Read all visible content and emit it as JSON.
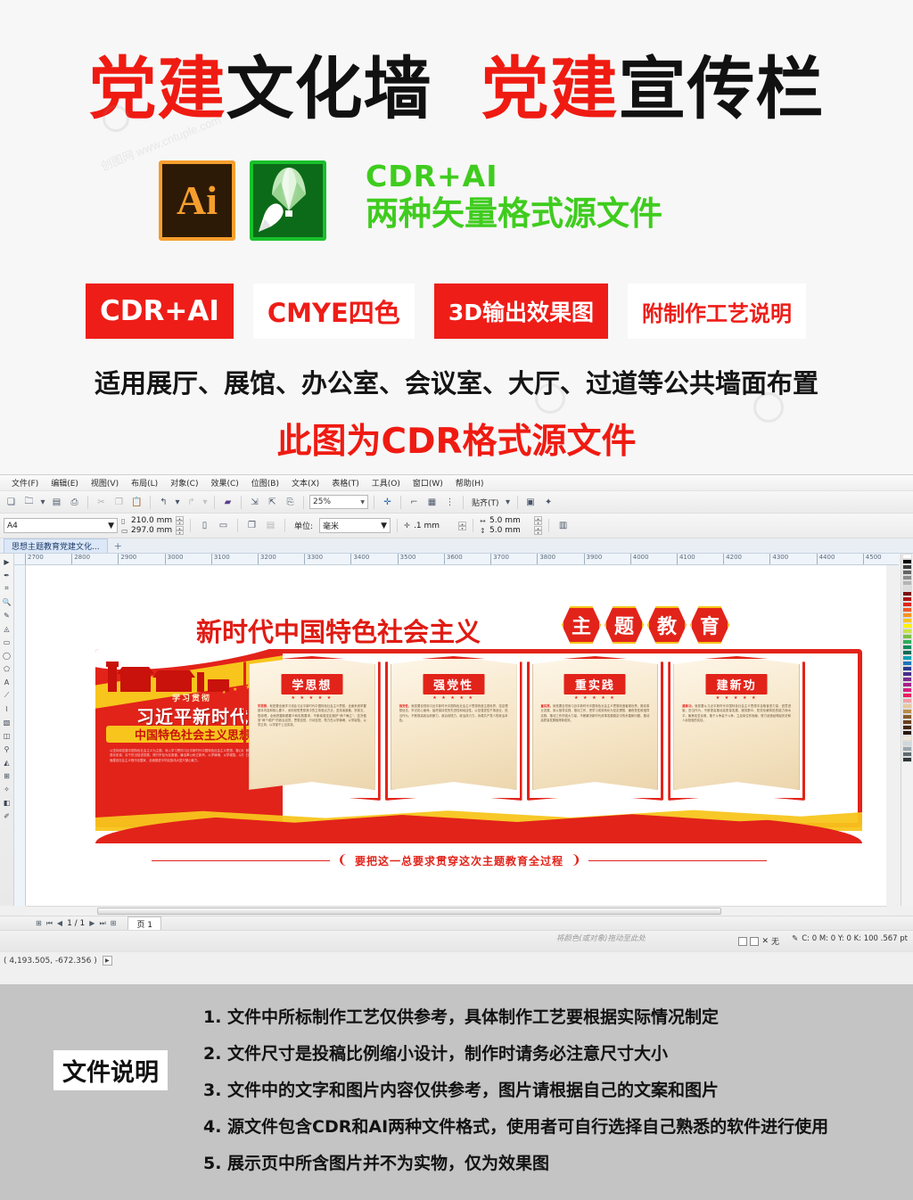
{
  "promo": {
    "title_parts": [
      {
        "text": "党建",
        "color": "red"
      },
      {
        "text": "文化墙",
        "color": "black"
      },
      {
        "text": " ",
        "color": "black"
      },
      {
        "text": "党建",
        "color": "red"
      },
      {
        "text": "宣传栏",
        "color": "black"
      }
    ],
    "title_red_1": "党建",
    "title_black_1": "文化墙",
    "title_red_2": "党建",
    "title_black_2": "宣传栏",
    "ai_icon_label": "Ai",
    "cdr_icon_label": "coreldraw-balloon-icon",
    "green_line1": "CDR+AI",
    "green_line2": "两种矢量格式源文件",
    "badges": [
      {
        "label": "CDR+AI",
        "style": "fill"
      },
      {
        "label": "CMYE四色",
        "style": "hollow"
      },
      {
        "label": "3D输出效果图",
        "style": "fill"
      },
      {
        "label": "附制作工艺说明",
        "style": "hollow"
      }
    ],
    "line1": "适用展厅、展馆、办公室、会议室、大厅、过道等公共墙面布置",
    "line2": "此图为CDR格式源文件",
    "watermark": "创图网 www.cntuple.com"
  },
  "colors": {
    "red": "#ee1d18",
    "art_red": "#e2231a",
    "yellow": "#f7c51c",
    "green": "#3fcc1e",
    "footer_bg": "#c4c4c4"
  },
  "app": {
    "menus": [
      "文件(F)",
      "编辑(E)",
      "视图(V)",
      "布局(L)",
      "对象(C)",
      "效果(C)",
      "位图(B)",
      "文本(X)",
      "表格(T)",
      "工具(O)",
      "窗口(W)",
      "帮助(H)"
    ],
    "toolbar": {
      "icons": [
        "new-icon",
        "open-icon",
        "open-dropdown-icon",
        "save-icon",
        "print-icon",
        "cut-icon",
        "copy-icon",
        "paste-icon",
        "undo-icon",
        "undo-dropdown-icon",
        "redo-icon",
        "redo-dropdown-icon",
        "import-icon",
        "export-icon",
        "publish-pdf-icon",
        "application-launcher-icon"
      ],
      "zoom_value": "25%",
      "snap_label": "贴齐(T)",
      "options_icon": "options-icon"
    },
    "propbar": {
      "page_size": "A4",
      "width": "210.0 mm",
      "height": "297.0 mm",
      "orientation_portrait_icon": "portrait-icon",
      "orientation_landscape_icon": "landscape-icon",
      "all_pages_icon": "all-pages-icon",
      "current_page_icon": "current-page-icon",
      "unit_label": "单位:",
      "unit_value": "毫米",
      "nudge_icon": "nudge-icon",
      "nudge_value": ".1 mm",
      "duplicate_x_value": "5.0 mm",
      "duplicate_y_value": "5.0 mm"
    },
    "doc_tab": "思想主题教育党建文化...",
    "tab_plus": "+",
    "ruler_ticks": [
      "2700",
      "2800",
      "2900",
      "3000",
      "3100",
      "3200",
      "3300",
      "3400",
      "3500",
      "3600",
      "3700",
      "3800",
      "3900",
      "4000",
      "4100",
      "4200",
      "4300",
      "4400",
      "4500"
    ],
    "page_nav": {
      "first_icon": "first-page-icon",
      "prev_icon": "prev-page-icon",
      "counter": "1 / 1",
      "next_icon": "next-page-icon",
      "last_icon": "last-page-icon",
      "add_page_icon": "add-page-icon",
      "page_tab": "页 1"
    },
    "status": {
      "hint": "将颜色(或对象)拖动至此处",
      "fill_label": "无",
      "color_readout": "C: 0 M: 0 Y: 0 K: 100 .567 pt"
    },
    "coordinates": "( 4,193.505, -672.356 )"
  },
  "artwork": {
    "headline": "新时代中国特色社会主义",
    "hexagons": [
      "主",
      "题",
      "教",
      "育"
    ],
    "left_panel": {
      "line1": "学习贯彻",
      "line2": "习近平新时代",
      "line3": "中国特色社会主义思想",
      "small_text": "以坚持和发展中国特色社会主义为主题，深入学习贯彻习近平新时代中国特色社会主义思想，凝心铸魂筑牢根本、锤炼品格强化忠诚、实干担当促进发展、践行宗旨为民造福、廉洁奉公树立新风，以学铸魂、以学增智、以学正风、以学促干，为全面建设社会主义现代化国家、全面推进中华民族伟大复兴凝心聚力。"
    },
    "books": [
      {
        "title": "学思想",
        "stars": "★ ★ ★ ★ ★",
        "keyword": "学思想，",
        "body": "就是要全面学习领会习近平新时代中国特色社会主义思想，全面系统掌握基本内容和核心要义，深刻领悟贯穿其中的立场观点方法，坚持读原著、学原文、悟原理，全面把握精髓要义和实践要求，不断增强坚定拥护“两个确立”、坚决做到“两个维护”的政治自觉、思想自觉、行动自觉，努力在以学铸魂、以学增智、以学正风、以学促干上见实效。"
      },
      {
        "title": "强党性",
        "stars": "★ ★ ★ ★ ★",
        "keyword": "强党性，",
        "body": "就是要自觉用习近平新时代中国特色社会主义思想改造主观世界，坚定理想信念，牢记初心使命，始终保持党的先进性和纯洁性，以坚强党性干事创业、担当作为，不断提高政治判断力、政治领悟力、政治执行力，永葆共产党人的政治本色。"
      },
      {
        "title": "重实践",
        "stars": "★ ★ ★ ★ ★",
        "keyword": "重实践，",
        "body": "就是要自觉用习近平新时代中国特色社会主义思想改造客观世界，推动事业发展，用以指导实践、推动工作，把学习成效转化为坚定理想、锤炼党性和指导实践、推动工作的强大力量，不断解决新时代改革发展稳定中的矛盾和问题，推动高质量发展取得新成效。"
      },
      {
        "title": "建新功",
        "stars": "★ ★ ★ ★ ★",
        "keyword": "建新功，",
        "body": "就是要从习近平新时代中国特色社会主义思想中汲取奋进力量，锐意进取、担当作为，不断提高推动高质量发展、服务群众、防范化解风险的能力和水平，聚焦攻坚克难，敢于斗争善于斗争，立足岗位作贡献，努力创造经得起历史和人民检验的实绩。"
      }
    ],
    "bottom_banner": "要把这一总要求贯穿这次主题教育全过程"
  },
  "footer": {
    "label": "文件说明",
    "items": [
      "1. 文件中所标制作工艺仅供参考，具体制作工艺要根据实际情况制定",
      "2. 文件尺寸是投稿比例缩小设计，制作时请务必注意尺寸大小",
      "3. 文件中的文字和图片内容仅供参考，图片请根据自己的文案和图片",
      "4. 源文件包含CDR和AI两种文件格式，使用者可自行选择自己熟悉的软件进行使用",
      "5. 展示页中所含图片并不为实物，仅为效果图"
    ]
  }
}
